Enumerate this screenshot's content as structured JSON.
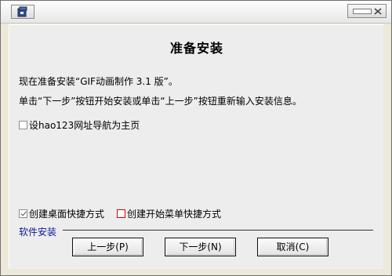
{
  "window": {
    "icon": "installer-app-icon",
    "controls": {
      "minimize": "minimize-icon",
      "close": "close-icon"
    }
  },
  "page": {
    "heading": "准备安装",
    "line1": "现在准备安装“GIF动画制作 3.1 版”。",
    "line2": "单击“下一步”按钮开始安装或单击“上一步”按钮重新输入安装信息。"
  },
  "options": {
    "hao123": {
      "label": "设hao123网址导航为主页",
      "checked": false
    },
    "desktop_shortcut": {
      "label": "创建桌面快捷方式",
      "checked": true
    },
    "start_menu_shortcut": {
      "label": "创建开始菜单快捷方式",
      "checked": false
    }
  },
  "footer": {
    "section_label": "软件安装",
    "back_label": "上一步(P)",
    "next_label": "下一步(N)",
    "cancel_label": "取消(C)"
  },
  "colors": {
    "section_label": "#0a1a9a",
    "start_menu_box_border": "#d60000",
    "dialog_bg": "#ededed"
  }
}
